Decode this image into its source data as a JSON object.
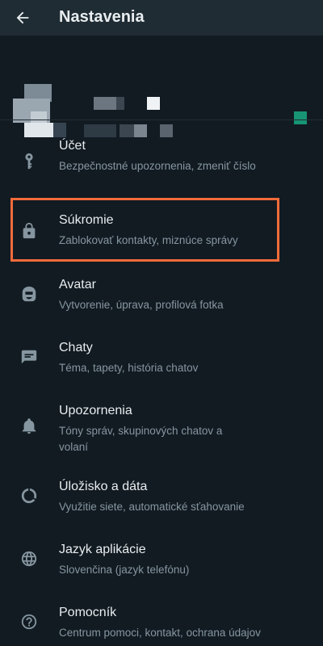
{
  "header": {
    "title": "Nastavenia"
  },
  "colors": {
    "background": "#121b22",
    "header": "#1f2c34",
    "accent": "#00a884",
    "highlight": "#f26b3a",
    "secondary_text": "#8696a0"
  },
  "items": [
    {
      "title": "Účet",
      "subtitle": "Bezpečnostné upozornenia, zmeniť číslo",
      "icon": "key-icon"
    },
    {
      "title": "Súkromie",
      "subtitle": "Zablokovať kontakty, miznúce správy",
      "icon": "lock-icon"
    },
    {
      "title": "Avatar",
      "subtitle": "Vytvorenie, úprava, profilová fotka",
      "icon": "avatar-icon"
    },
    {
      "title": "Chaty",
      "subtitle": "Téma, tapety, história chatov",
      "icon": "chat-icon"
    },
    {
      "title": "Upozornenia",
      "subtitle": "Tóny správ, skupinových chatov a volaní",
      "icon": "bell-icon"
    },
    {
      "title": "Úložisko a dáta",
      "subtitle": "Využitie siete, automatické sťahovanie",
      "icon": "data-usage-icon"
    },
    {
      "title": "Jazyk aplikácie",
      "subtitle": "Slovenčina (jazyk telefónu)",
      "icon": "globe-icon"
    },
    {
      "title": "Pomocník",
      "subtitle": "Centrum pomoci, kontakt, ochrana údajov",
      "icon": "help-icon"
    }
  ]
}
